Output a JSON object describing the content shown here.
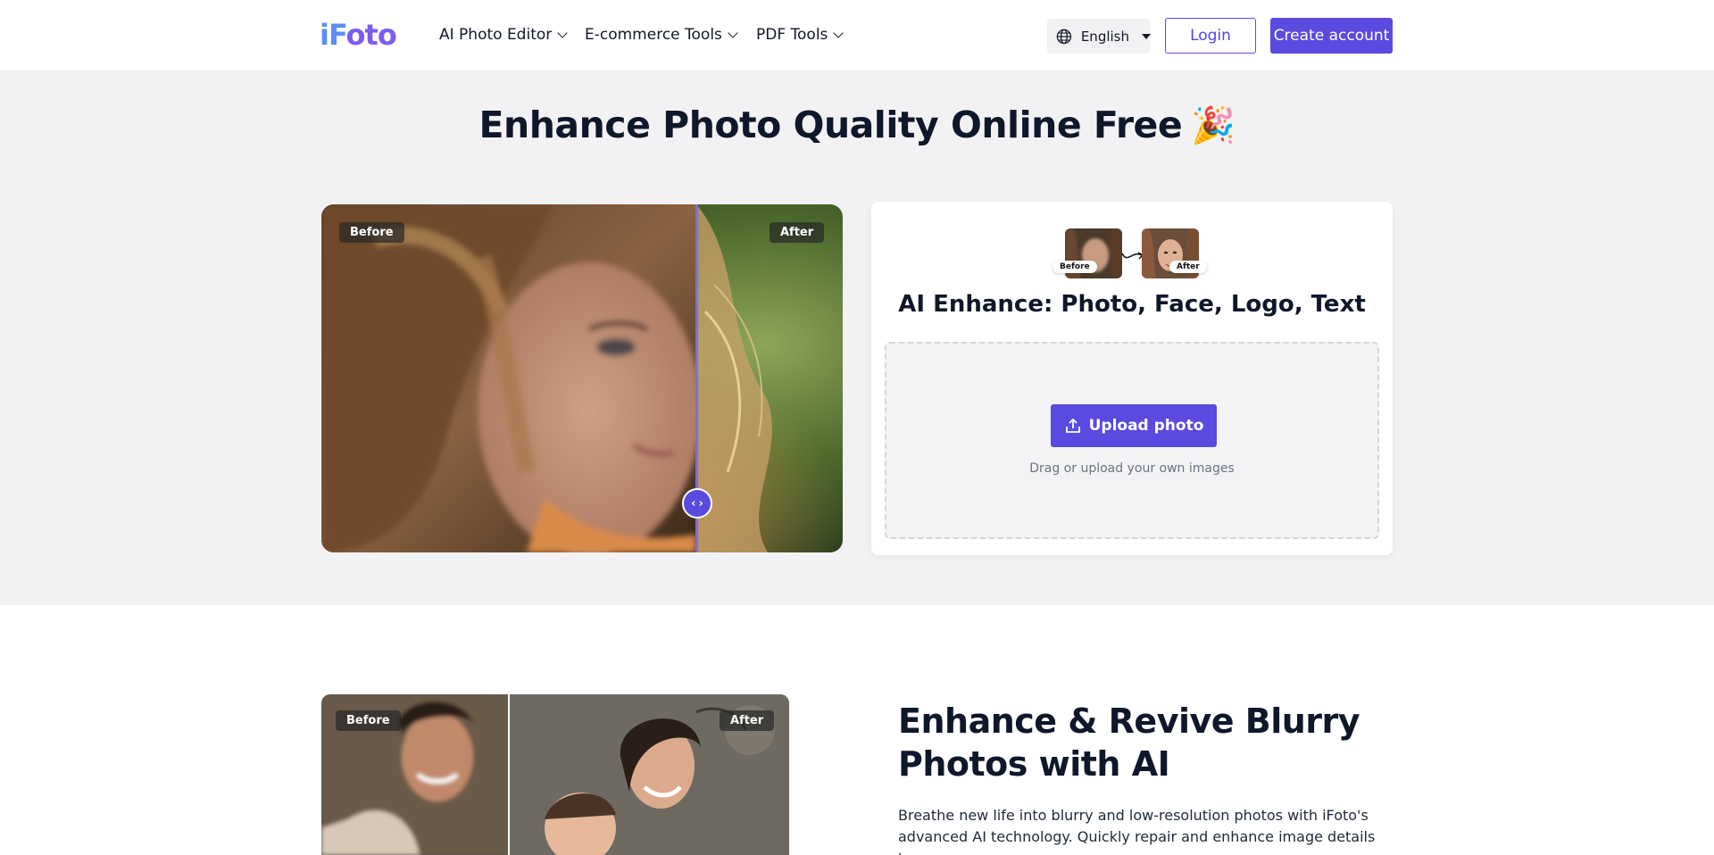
{
  "nav": {
    "logo": "iFoto",
    "logo_parts": [
      "iF",
      "oto"
    ],
    "items": [
      {
        "label": "AI Photo Editor",
        "icon": "chevron-down-icon"
      },
      {
        "label": "E-commerce Tools",
        "icon": "chevron-down-icon"
      },
      {
        "label": "PDF Tools",
        "icon": "chevron-down-icon"
      }
    ],
    "language": {
      "label": "English",
      "icon": "globe-icon"
    },
    "login_label": "Login",
    "create_label": "Create account"
  },
  "hero": {
    "title": "Enhance Photo Quality Online Free",
    "title_emoji": "🎉",
    "compare": {
      "before_label": "Before",
      "after_label": "After",
      "handle_icon": "compare-handle-icon",
      "split": 0.72
    }
  },
  "card": {
    "thumb_before_label": "Before",
    "thumb_after_label": "After",
    "title": "AI Enhance: Photo, Face, Logo, Text",
    "upload_label": "Upload photo",
    "upload_icon": "upload-icon",
    "hint": "Drag or upload your own images"
  },
  "section2": {
    "before_label": "Before",
    "after_label": "After",
    "title": "Enhance & Revive Blurry Photos with AI",
    "text": "Breathe new life into blurry and low-resolution photos with iFoto's advanced AI technology. Quickly repair and enhance image details to"
  },
  "colors": {
    "accent": "#5b4ae0",
    "hero_bg": "#f2f2f5",
    "logo_blue": "#5b8df6",
    "logo_purple": "#7b5cf0"
  }
}
